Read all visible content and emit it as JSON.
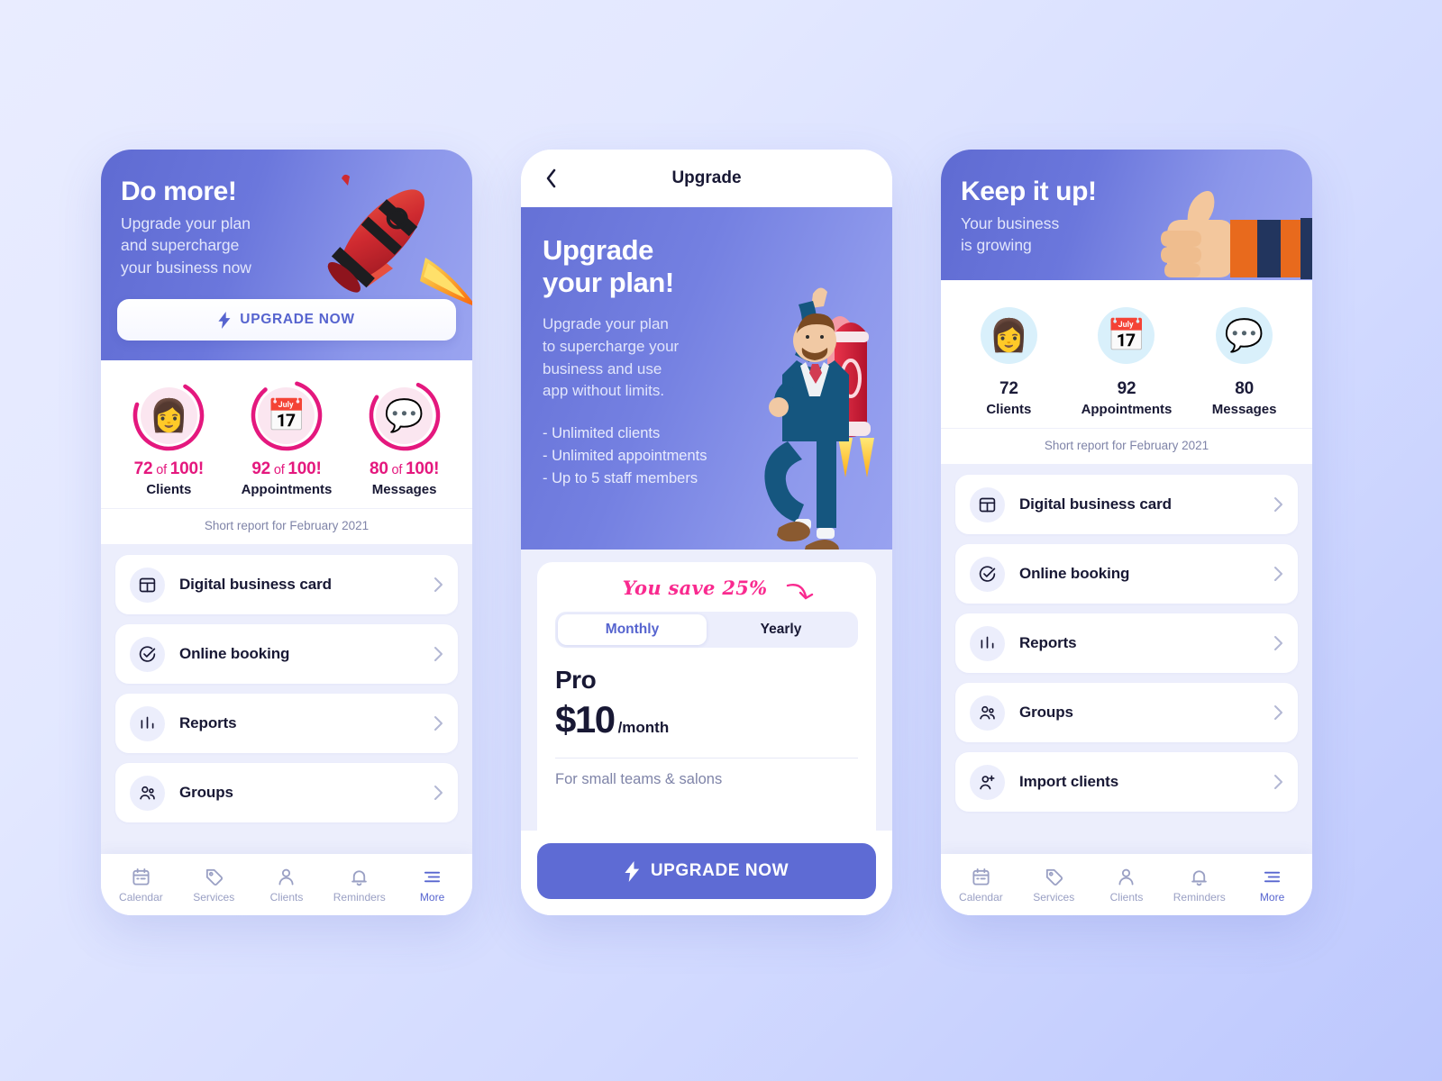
{
  "background": {
    "from": "#e9ecff",
    "to": "#bcc7fd"
  },
  "accent": {
    "purple": "#5664cf",
    "purple_dark": "#5e6bd4",
    "pink": "#e4187e",
    "pink_bright": "#f92a8f",
    "ink": "#181834",
    "muted": "#7f84a8"
  },
  "phone1": {
    "hero": {
      "title": "Do more!",
      "subtitle": "Upgrade your plan\nand supercharge\nyour business now",
      "cta_label": "UPGRADE NOW",
      "art": "rocket-illustration"
    },
    "stats": [
      {
        "icon": "woman-avatar-icon",
        "value": "72",
        "of": " of ",
        "total": "100!",
        "label": "Clients",
        "percent": 72
      },
      {
        "icon": "calendar-bag-icon",
        "value": "92",
        "of": " of ",
        "total": "100!",
        "label": "Appointments",
        "percent": 92
      },
      {
        "icon": "speech-bubble-icon",
        "value": "80",
        "of": " of ",
        "total": "100!",
        "label": "Messages",
        "percent": 80
      }
    ],
    "report_note": "Short report for February 2021",
    "menu": [
      {
        "icon": "layout-card-icon",
        "label": "Digital business card"
      },
      {
        "icon": "check-circle-icon",
        "label": "Online booking"
      },
      {
        "icon": "bar-chart-icon",
        "label": "Reports"
      },
      {
        "icon": "group-people-icon",
        "label": "Groups"
      }
    ],
    "tabs": [
      {
        "icon": "calendar-icon",
        "label": "Calendar",
        "active": false
      },
      {
        "icon": "tag-icon",
        "label": "Services",
        "active": false
      },
      {
        "icon": "person-icon",
        "label": "Clients",
        "active": false
      },
      {
        "icon": "bell-icon",
        "label": "Reminders",
        "active": false
      },
      {
        "icon": "menu-lines-icon",
        "label": "More",
        "active": true
      }
    ]
  },
  "phone2": {
    "navbar": {
      "back_icon": "chevron-left-icon",
      "title": "Upgrade"
    },
    "promo": {
      "title": "Upgrade\nyour plan!",
      "paragraph": "Upgrade your plan\nto supercharge your\nbusiness and use\napp without limits.",
      "bullets": [
        "- Unlimited clients",
        "- Unlimited appointments",
        "- Up to 5 staff members"
      ],
      "art": "businessman-rocket-illustration"
    },
    "plan": {
      "save_note": "You save 25%",
      "save_arrow_icon": "curved-arrow-icon",
      "billing_options": [
        {
          "label": "Monthly",
          "selected": true
        },
        {
          "label": "Yearly",
          "selected": false
        }
      ],
      "name": "Pro",
      "price": "$10",
      "period": "/month",
      "description": "For small teams & salons"
    },
    "cta_label": "UPGRADE NOW"
  },
  "phone3": {
    "hero": {
      "title": "Keep it up!",
      "subtitle": "Your business\nis growing",
      "art": "thumbs-up-illustration"
    },
    "stats": [
      {
        "icon": "woman-avatar-icon",
        "value": "72",
        "label": "Clients"
      },
      {
        "icon": "calendar-bag-icon",
        "value": "92",
        "label": "Appointments"
      },
      {
        "icon": "speech-bubble-icon",
        "value": "80",
        "label": "Messages"
      }
    ],
    "report_note": "Short report for February 2021",
    "menu": [
      {
        "icon": "layout-card-icon",
        "label": "Digital business card"
      },
      {
        "icon": "check-circle-icon",
        "label": "Online booking"
      },
      {
        "icon": "bar-chart-icon",
        "label": "Reports"
      },
      {
        "icon": "group-people-icon",
        "label": "Groups"
      },
      {
        "icon": "add-person-icon",
        "label": "Import clients"
      }
    ],
    "tabs": [
      {
        "icon": "calendar-icon",
        "label": "Calendar",
        "active": false
      },
      {
        "icon": "tag-icon",
        "label": "Services",
        "active": false
      },
      {
        "icon": "person-icon",
        "label": "Clients",
        "active": false
      },
      {
        "icon": "bell-icon",
        "label": "Reminders",
        "active": false
      },
      {
        "icon": "menu-lines-icon",
        "label": "More",
        "active": true
      }
    ]
  }
}
